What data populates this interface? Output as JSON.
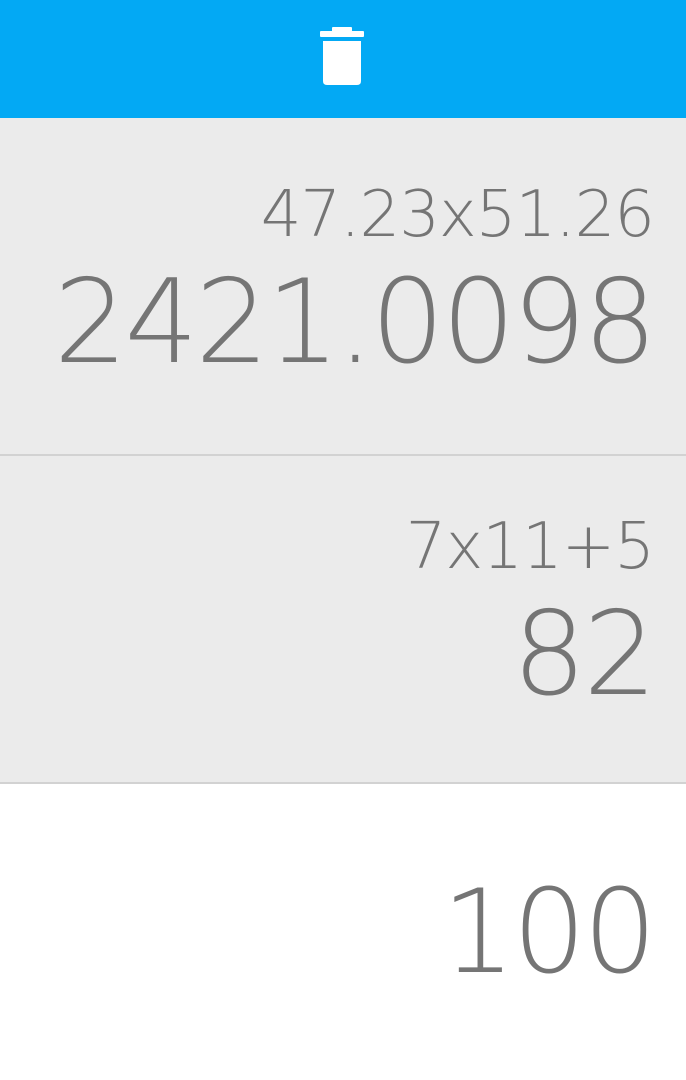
{
  "toolbar": {
    "color": "#03A9F4",
    "clear_icon": "trash-icon"
  },
  "history": [
    {
      "expression": "47.23x51.26",
      "result": "2421.0098"
    },
    {
      "expression": "7x11+5",
      "result": "82"
    }
  ],
  "display": {
    "value": "100"
  }
}
